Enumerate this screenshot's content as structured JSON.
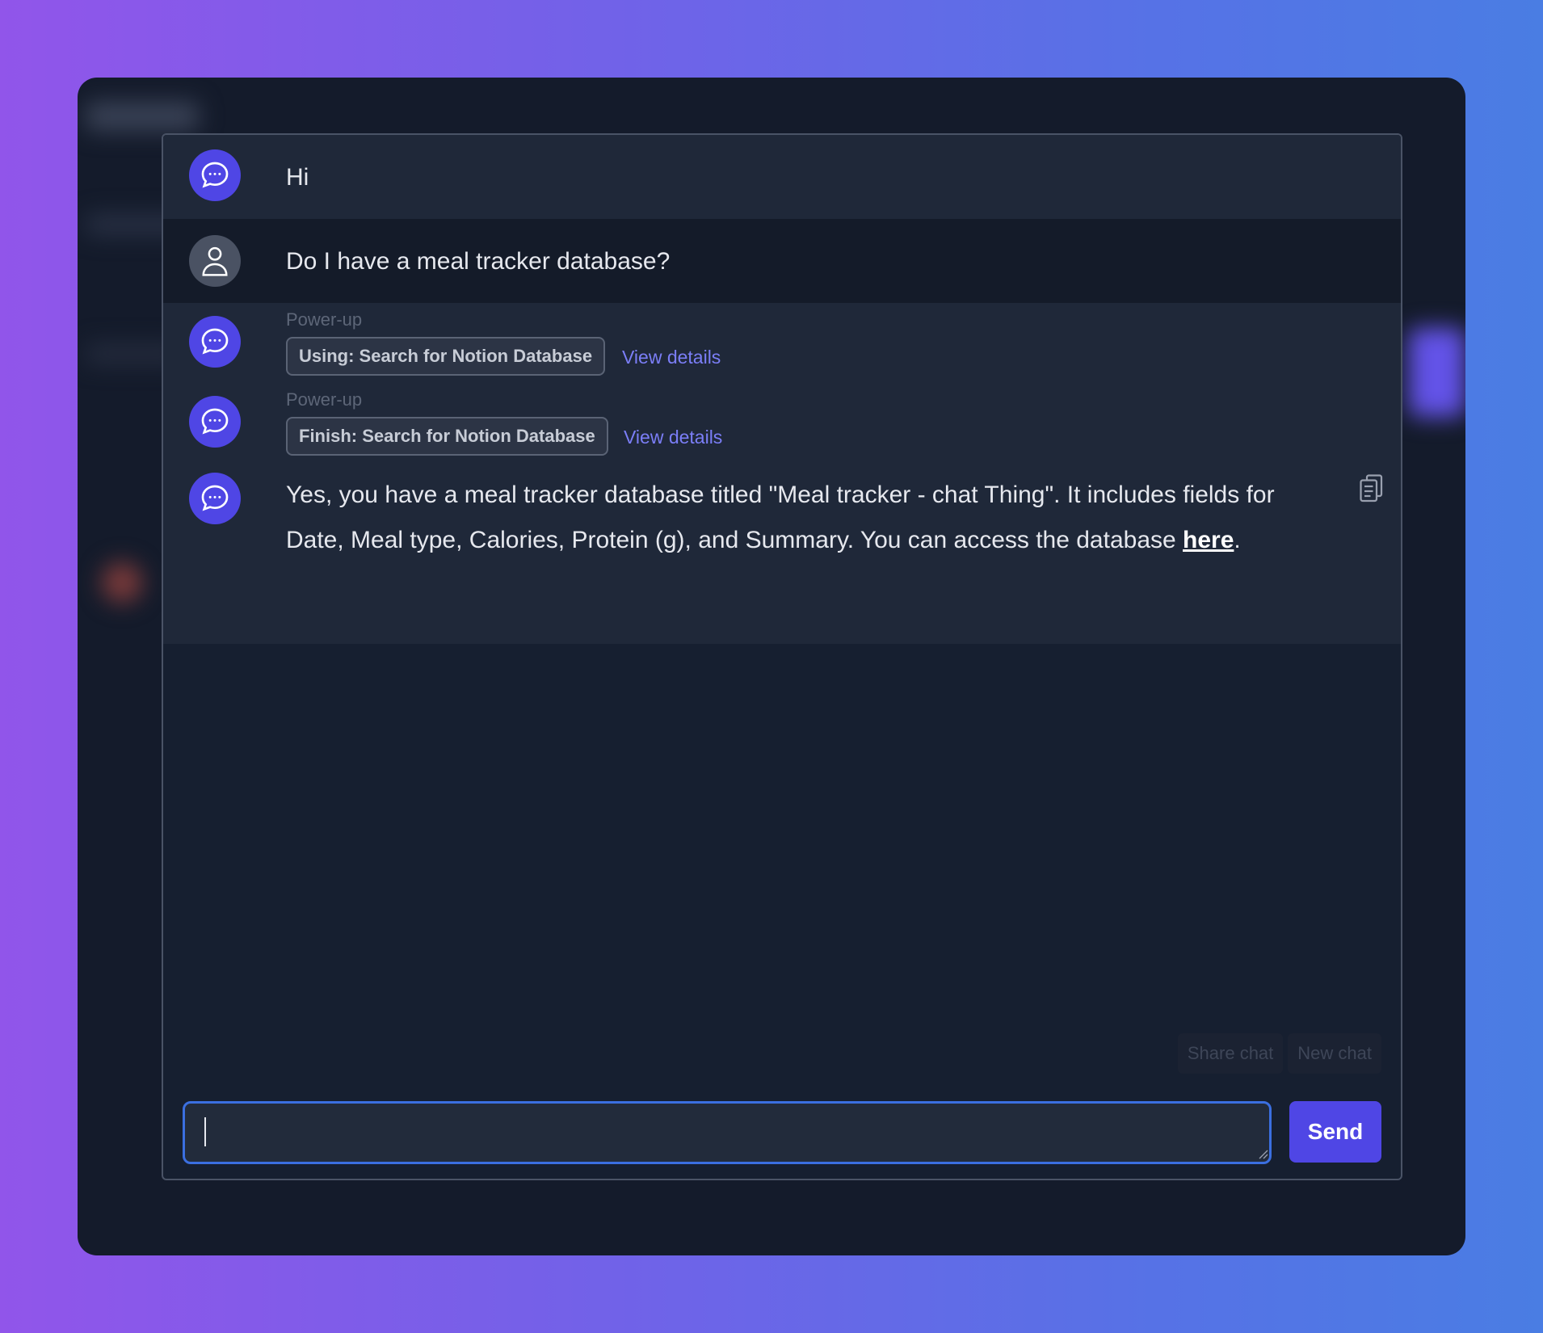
{
  "messages": {
    "greeting": "Hi",
    "user_question": "Do I have a meal tracker database?",
    "powerups": [
      {
        "label": "Power-up",
        "pill": "Using: Search for Notion Database",
        "link": "View details"
      },
      {
        "label": "Power-up",
        "pill": "Finish: Search for Notion Database",
        "link": "View details"
      }
    ],
    "answer": {
      "text": "Yes, you have a meal tracker database titled \"Meal tracker - chat Thing\". It includes fields for Date, Meal type, Calories, Protein (g), and Summary. You can access the database ",
      "link": "here",
      "suffix": "."
    }
  },
  "actions": {
    "share": "Share chat",
    "new": "New chat"
  },
  "composer": {
    "value": "",
    "send_label": "Send"
  },
  "colors": {
    "accent": "#4f46e5",
    "link": "#7b7ef7",
    "focus_border": "#3b6fe0"
  },
  "icons": {
    "bot": "chat-bubble-icon",
    "user": "user-icon",
    "copy": "clipboard-icon"
  }
}
